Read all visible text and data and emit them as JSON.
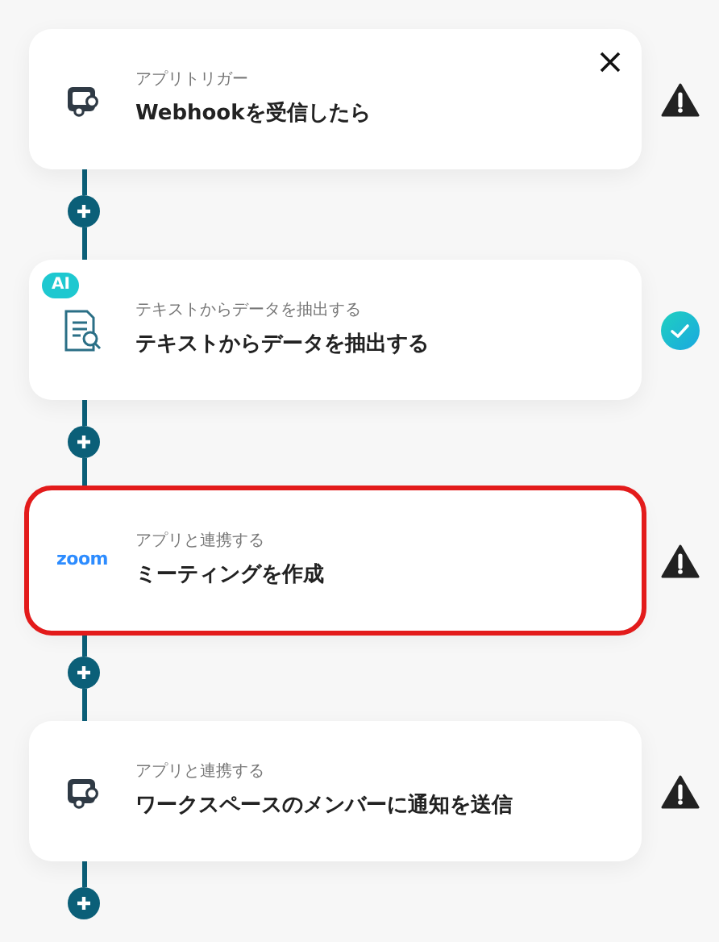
{
  "steps": [
    {
      "kind": "app",
      "caption": "アプリトリガー",
      "title": "Webhookを受信したら",
      "validated": false,
      "selected": false,
      "closable": true
    },
    {
      "kind": "ai",
      "badge": "AI",
      "caption": "テキストからデータを抽出する",
      "title": "テキストからデータを抽出する",
      "validated": true,
      "selected": false,
      "closable": false
    },
    {
      "kind": "logo",
      "logo_text": "zoom",
      "caption": "アプリと連携する",
      "title": "ミーティングを作成",
      "validated": false,
      "selected": true,
      "closable": false
    },
    {
      "kind": "app",
      "caption": "アプリと連携する",
      "title": "ワークスペースのメンバーに通知を送信",
      "validated": false,
      "selected": false,
      "closable": false
    }
  ]
}
